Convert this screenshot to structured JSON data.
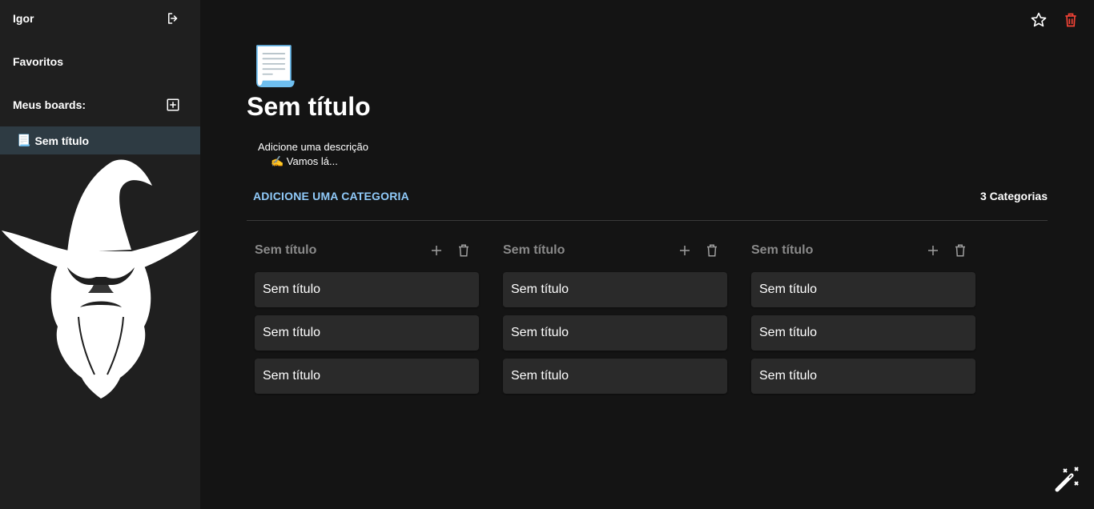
{
  "sidebar": {
    "user_name": "Igor",
    "favorites_label": "Favoritos",
    "my_boards_label": "Meus boards:",
    "boards": [
      {
        "emoji": "📃",
        "title": "Sem título"
      }
    ]
  },
  "board": {
    "emoji": "📃",
    "title": "Sem título",
    "description_label": "Adicione uma descrição",
    "description_placeholder": "✍️ Vamos lá...",
    "add_category_label": "Adicione uma categoria",
    "category_count": "3 Categorias"
  },
  "columns": [
    {
      "title": "Sem título",
      "cards": [
        "Sem título",
        "Sem título",
        "Sem título"
      ]
    },
    {
      "title": "Sem título",
      "cards": [
        "Sem título",
        "Sem título",
        "Sem título"
      ]
    },
    {
      "title": "Sem título",
      "cards": [
        "Sem título",
        "Sem título",
        "Sem título"
      ]
    }
  ],
  "colors": {
    "background": "#141414",
    "sidebar": "#1f1f1f",
    "active_item": "#2e3b43",
    "accent": "#90caf9",
    "delete": "#f44336",
    "card": "#2a2a2a"
  },
  "icons": {
    "logout": "logout-icon",
    "add_board": "add-box-icon",
    "favorite": "star-outline-icon",
    "delete": "trash-icon",
    "add": "plus-icon",
    "magic": "magic-wand-icon"
  }
}
